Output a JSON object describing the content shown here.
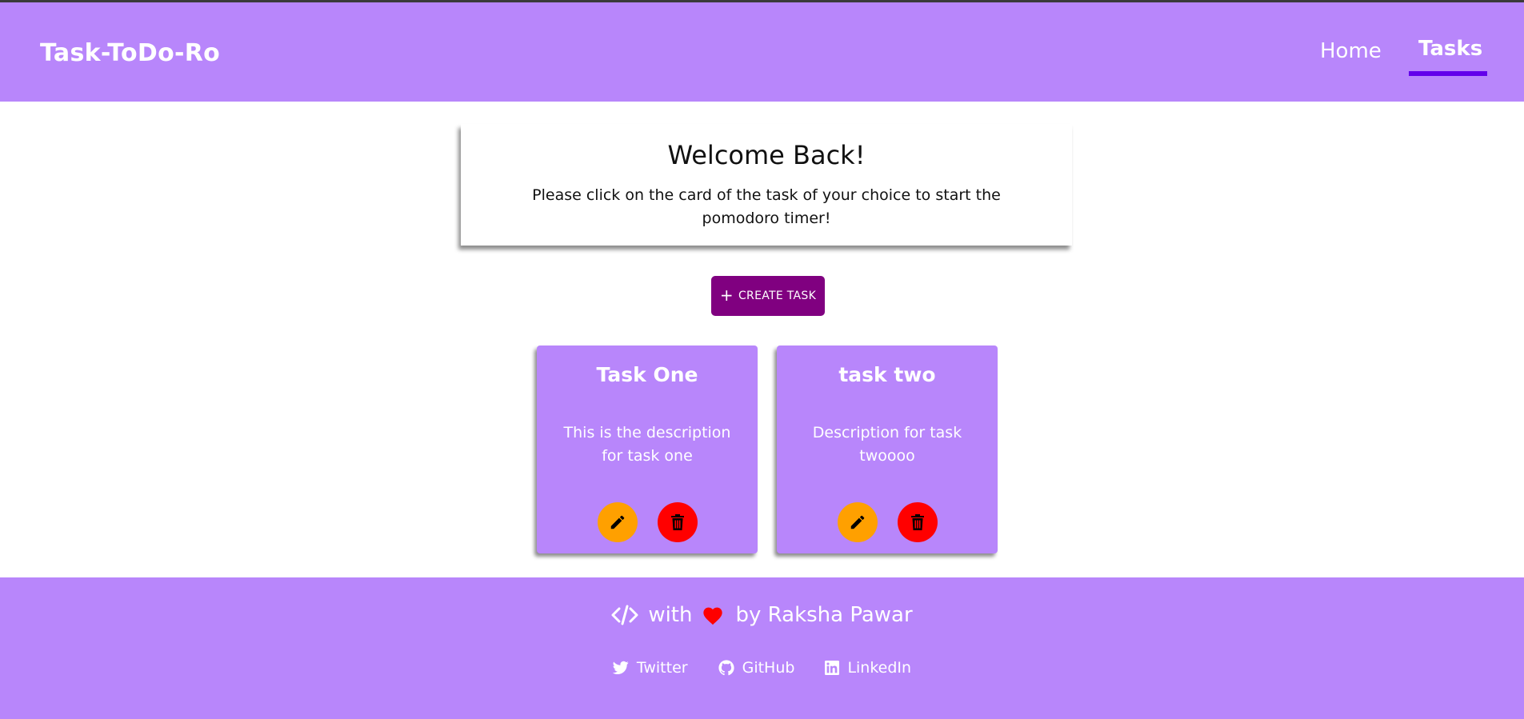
{
  "header": {
    "brand": "Task-ToDo-Ro",
    "nav": {
      "home": "Home",
      "tasks": "Tasks"
    },
    "active_nav": "Tasks"
  },
  "welcome": {
    "title": "Welcome Back!",
    "subtitle": "Please click on the card of the task of your choice to start the pomodoro timer!"
  },
  "actions": {
    "create_label": "CREATE TASK",
    "create_icon": "plus-icon"
  },
  "tasks": [
    {
      "title": "Task One",
      "description": "This is the description for task one"
    },
    {
      "title": "task two",
      "description": "Description for task twoooo"
    }
  ],
  "task_actions": {
    "edit_icon": "pencil-icon",
    "delete_icon": "trash-icon"
  },
  "footer": {
    "with_text": "with",
    "by_text": "by Raksha Pawar",
    "links": {
      "twitter": "Twitter",
      "github": "GitHub",
      "linkedin": "LinkedIn"
    }
  },
  "colors": {
    "primary": "#b886fb",
    "nav_underline": "#6200ea",
    "create_button": "#800080",
    "edit_button": "#ffa000",
    "delete_button": "#ff0000",
    "heart": "#ff0000"
  }
}
